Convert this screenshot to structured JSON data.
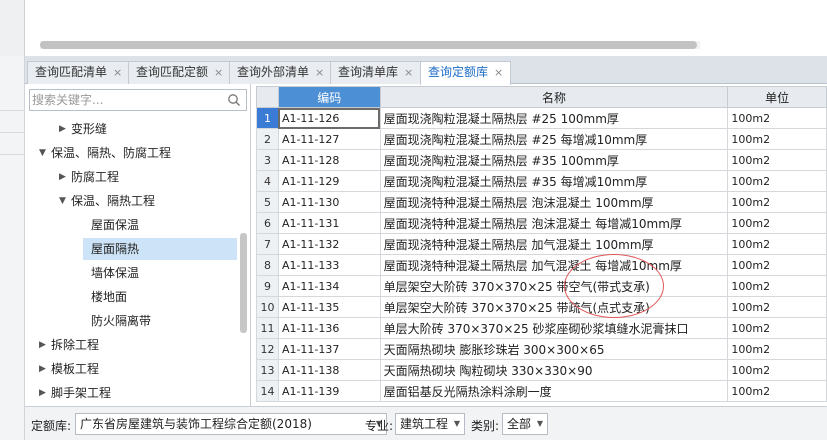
{
  "tabs": [
    {
      "label": "查询匹配清单",
      "active": false
    },
    {
      "label": "查询匹配定额",
      "active": false
    },
    {
      "label": "查询外部清单",
      "active": false
    },
    {
      "label": "查询清单库",
      "active": false
    },
    {
      "label": "查询定额库",
      "active": true
    }
  ],
  "close_glyph": "×",
  "search": {
    "placeholder": "搜索关键字..."
  },
  "tree": [
    {
      "label": "变形缝",
      "level": 2,
      "expand": "collapsed"
    },
    {
      "label": "保温、隔热、防腐工程",
      "level": 1,
      "expand": "expanded"
    },
    {
      "label": "防腐工程",
      "level": 2,
      "expand": "collapsed"
    },
    {
      "label": "保温、隔热工程",
      "level": 2,
      "expand": "expanded"
    },
    {
      "label": "屋面保温",
      "level": 3,
      "expand": "none"
    },
    {
      "label": "屋面隔热",
      "level": 3,
      "expand": "none",
      "selected": true
    },
    {
      "label": "墙体保温",
      "level": 3,
      "expand": "none"
    },
    {
      "label": "楼地面",
      "level": 3,
      "expand": "none"
    },
    {
      "label": "防火隔离带",
      "level": 3,
      "expand": "none"
    },
    {
      "label": "拆除工程",
      "level": 1,
      "expand": "collapsed"
    },
    {
      "label": "模板工程",
      "level": 1,
      "expand": "collapsed"
    },
    {
      "label": "脚手架工程",
      "level": 1,
      "expand": "collapsed"
    }
  ],
  "grid": {
    "headers": {
      "code": "编码",
      "name": "名称",
      "unit": "单位"
    },
    "rows": [
      {
        "num": "1",
        "code": "A1-11-126",
        "name": "屋面现浇陶粒混凝土隔热层 #25 100mm厚",
        "unit": "100m2"
      },
      {
        "num": "2",
        "code": "A1-11-127",
        "name": "屋面现浇陶粒混凝土隔热层 #25 每增减10mm厚",
        "unit": "100m2"
      },
      {
        "num": "3",
        "code": "A1-11-128",
        "name": "屋面现浇陶粒混凝土隔热层 #35 100mm厚",
        "unit": "100m2"
      },
      {
        "num": "4",
        "code": "A1-11-129",
        "name": "屋面现浇陶粒混凝土隔热层 #35 每增减10mm厚",
        "unit": "100m2"
      },
      {
        "num": "5",
        "code": "A1-11-130",
        "name": "屋面现浇特种混凝土隔热层 泡沫混凝土 100mm厚",
        "unit": "100m2"
      },
      {
        "num": "6",
        "code": "A1-11-131",
        "name": "屋面现浇特种混凝土隔热层 泡沫混凝土 每增减10mm厚",
        "unit": "100m2"
      },
      {
        "num": "7",
        "code": "A1-11-132",
        "name": "屋面现浇特种混凝土隔热层 加气混凝土 100mm厚",
        "unit": "100m2"
      },
      {
        "num": "8",
        "code": "A1-11-133",
        "name": "屋面现浇特种混凝土隔热层 加气混凝土 每增减10mm厚",
        "unit": "100m2"
      },
      {
        "num": "9",
        "code": "A1-11-134",
        "name": "单层架空大阶砖 370×370×25 带空气(带式支承)",
        "unit": "100m2"
      },
      {
        "num": "10",
        "code": "A1-11-135",
        "name": "单层架空大阶砖 370×370×25 带疏气(点式支承)",
        "unit": "100m2"
      },
      {
        "num": "11",
        "code": "A1-11-136",
        "name": "单层大阶砖 370×370×25 砂浆座砌砂浆填缝水泥膏抹口",
        "unit": "100m2"
      },
      {
        "num": "12",
        "code": "A1-11-137",
        "name": "天面隔热砌块 膨胀珍珠岩 300×300×65",
        "unit": "100m2"
      },
      {
        "num": "13",
        "code": "A1-11-138",
        "name": "天面隔热砌块 陶粒砌块 330×330×90",
        "unit": "100m2"
      },
      {
        "num": "14",
        "code": "A1-11-139",
        "name": "屋面铝基反光隔热涂料涂刷一度",
        "unit": "100m2"
      }
    ]
  },
  "bottom": {
    "quota_label": "定额库:",
    "quota_value": "广东省房屋建筑与装饰工程综合定额(2018)",
    "major_label": "专业:",
    "major_value": "建筑工程",
    "category_label": "类别:",
    "category_value": "全部"
  },
  "colors": {
    "accent": "#4d8fd4",
    "selected_row": "#3a7bd5",
    "annotation": "#e05a5a"
  }
}
